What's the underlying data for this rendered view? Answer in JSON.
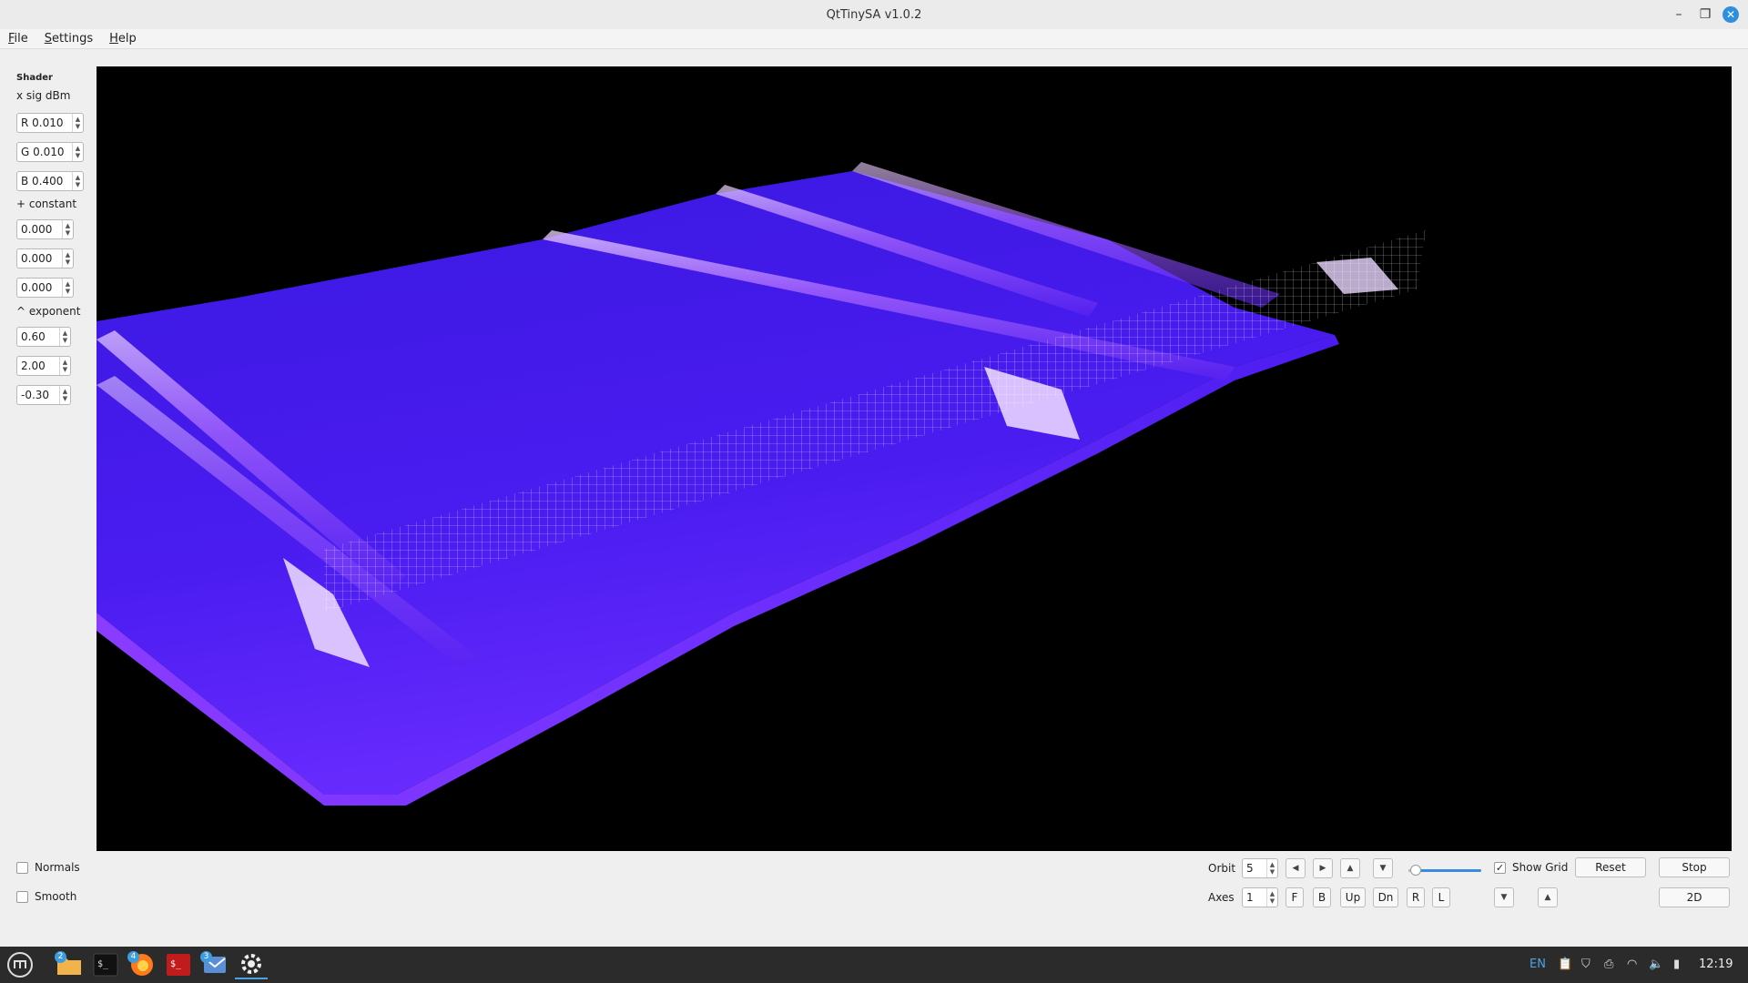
{
  "window": {
    "title": "QtTinySA v1.0.2"
  },
  "menu": [
    {
      "label": "File",
      "u": "F",
      "rest": "ile"
    },
    {
      "label": "Settings",
      "u": "S",
      "rest": "ettings"
    },
    {
      "label": "Help",
      "u": "H",
      "rest": "elp"
    }
  ],
  "left_panel": {
    "shader_label": "Shader",
    "sig_label": "x sig dBm",
    "r_value": "R 0.010",
    "g_value": "G 0.010",
    "b_value": "B 0.400",
    "constant_label": "+ constant",
    "constant_values": [
      "0.000",
      "0.000",
      "0.000"
    ],
    "exponent_label": "^ exponent",
    "exponent_values": [
      "0.60",
      "2.00",
      "-0.30"
    ],
    "normals_label": "Normals",
    "smooth_label": "Smooth"
  },
  "controls": {
    "orbit_label": "Orbit",
    "orbit_value": "5",
    "axes_label": "Axes",
    "axes_value": "1",
    "axes_buttons": [
      "F",
      "B",
      "Up",
      "Dn",
      "R",
      "L"
    ],
    "show_grid_label": "Show Grid",
    "show_grid_checked": true,
    "reset_label": "Reset",
    "stop_label": "Stop",
    "mode_2d_label": "2D",
    "slider_level": 0.05
  },
  "taskbar": {
    "apps": [
      {
        "icon": "menu-icon",
        "badge": ""
      },
      {
        "icon": "folder-icon",
        "badge": "2"
      },
      {
        "icon": "terminal-icon",
        "badge": ""
      },
      {
        "icon": "firefox-icon",
        "badge": "4"
      },
      {
        "icon": "terminal-red-icon",
        "badge": ""
      },
      {
        "icon": "mail-icon",
        "badge": "3"
      },
      {
        "icon": "settings-icon",
        "badge": ""
      }
    ],
    "lang": "EN",
    "time": "12:19"
  },
  "colors": {
    "accent": "#3a8be0",
    "surface_dark": "#2e14d8",
    "surface_light": "#a35cff"
  }
}
